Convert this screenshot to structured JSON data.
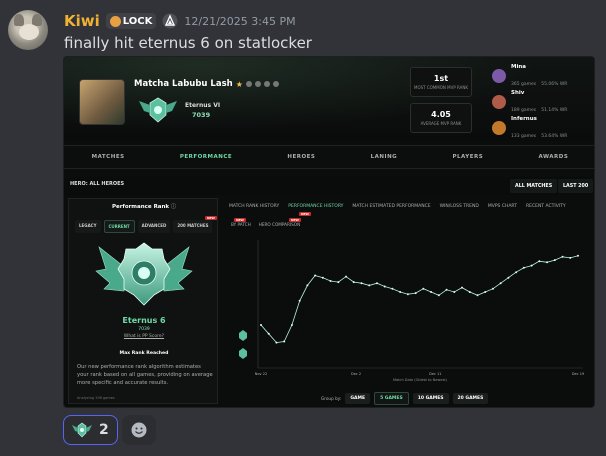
{
  "message": {
    "username": "Kiwi",
    "tag_label": "LOCK",
    "timestamp": "12/21/2025 3:45 PM",
    "text": "finally hit eternus 6 on statlocker"
  },
  "screenshot": {
    "player": {
      "name": "Matcha Labubu Lash",
      "rank": "Eternus VI",
      "points": "7039"
    },
    "stats": [
      {
        "value": "1st",
        "label": "MOST COMMON MVP RANK"
      },
      {
        "value": "4.05",
        "label": "AVERAGE MVP RANK"
      }
    ],
    "top_heroes": [
      {
        "name": "Mina",
        "games": "365 games",
        "wr": "55.06% WR",
        "color": "#7c5aa8"
      },
      {
        "name": "Shiv",
        "games": "189 games",
        "wr": "51.14% WR",
        "color": "#b05a4a"
      },
      {
        "name": "Infernus",
        "games": "133 games",
        "wr": "53.64% WR",
        "color": "#c27a2a"
      }
    ],
    "nav": [
      "MATCHES",
      "PERFORMANCE",
      "HEROES",
      "LANING",
      "PLAYERS",
      "AWARDS"
    ],
    "nav_active": "PERFORMANCE",
    "hero_filter": "HERO: ALL HEROES",
    "all_matches": "ALL MATCHES",
    "last_200": "LAST 200",
    "perf_panel": {
      "title": "Performance Rank",
      "tabs": [
        "LEGACY",
        "CURRENT",
        "ADVANCED",
        "200 MATCHES"
      ],
      "active_tab": "CURRENT",
      "rank": "Eternus 6",
      "points": "7039",
      "link": "What is PP Score?",
      "max_rank": "Max Rank Reached",
      "description": "Our new performance rank algorithm estimates your rank based on all games, providing on average more specific and accurate results.",
      "footer": "Analyzing 198 games"
    },
    "chart_tabs": [
      "MATCH RANK HISTORY",
      "PERFORMANCE HISTORY",
      "MATCH ESTIMATED PERFORMANCE",
      "WIN/LOSS TREND",
      "MVPS CHART",
      "RECENT ACTIVITY"
    ],
    "chart_tab_active": "PERFORMANCE HISTORY",
    "chart_subtabs": [
      "BY PATCH",
      "HERO COMPARISON"
    ],
    "new_label": "NEW",
    "group_by_label": "Group by:",
    "group_by_options": [
      "GAME",
      "5 GAMES",
      "10 GAMES",
      "20 GAMES"
    ],
    "group_by_active": "5 GAMES"
  },
  "chart_data": {
    "type": "line",
    "xlabel": "Match Date (Oldest to Newest)",
    "x_ticks": [
      "Nov 22",
      "Dec 2",
      "Dec 11",
      "Dec 19"
    ],
    "values": [
      3.0,
      2.2,
      1.4,
      1.5,
      3.0,
      5.2,
      6.6,
      7.5,
      7.3,
      7.0,
      6.9,
      7.4,
      6.9,
      6.8,
      6.6,
      6.8,
      6.5,
      6.3,
      6.0,
      5.8,
      5.9,
      6.3,
      6.0,
      5.7,
      6.2,
      6.0,
      6.4,
      6.0,
      5.7,
      6.0,
      6.3,
      6.8,
      7.3,
      7.8,
      8.2,
      8.4,
      8.8,
      8.7,
      8.9,
      9.2,
      9.1,
      9.3
    ],
    "ylim": [
      0,
      10
    ]
  },
  "reactions": [
    {
      "count": "2"
    }
  ],
  "colors": {
    "accent": "#6fd9a6",
    "username": "#f0b232",
    "line": "#b9f0e0"
  }
}
